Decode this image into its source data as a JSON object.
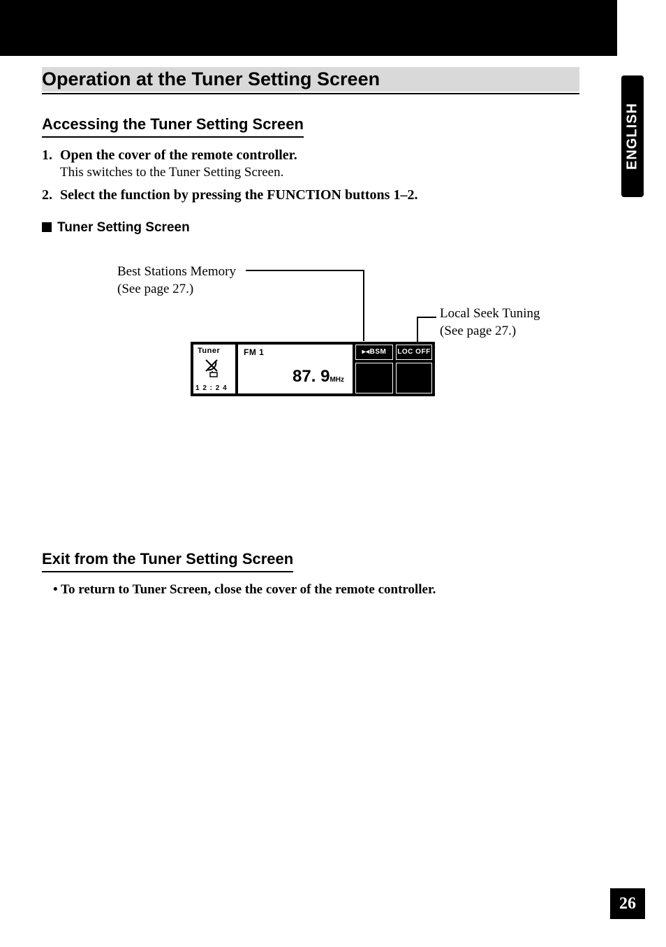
{
  "sidetab": {
    "label": "ENGLISH"
  },
  "h1": "Operation at the Tuner Setting Screen",
  "section_access": {
    "heading": "Accessing the Tuner Setting Screen",
    "step1_num": "1.",
    "step1_bold": "Open the cover of the remote controller.",
    "step1_note": "This switches to the Tuner Setting Screen.",
    "step2_num": "2.",
    "step2_bold": "Select the function by pressing the FUNCTION buttons 1–2."
  },
  "subheading": "Tuner Setting Screen",
  "callouts": {
    "bsm_line1": "Best Stations Memory",
    "bsm_line2": "(See page 27.)",
    "loc_line1": "Local Seek Tuning",
    "loc_line2": "(See page 27.)"
  },
  "lcd": {
    "source": "Tuner",
    "band": "FM 1",
    "freq_main": "87. 9",
    "freq_unit": "MHz",
    "clock": "1 2 : 2 4",
    "btn_bsm": "▸◂BSM",
    "btn_loc": "LOC OFF"
  },
  "section_exit": {
    "heading": "Exit from the Tuner Setting Screen",
    "bullet": "•  To return to Tuner Screen, close the cover of the remote controller."
  },
  "page_number": "26"
}
